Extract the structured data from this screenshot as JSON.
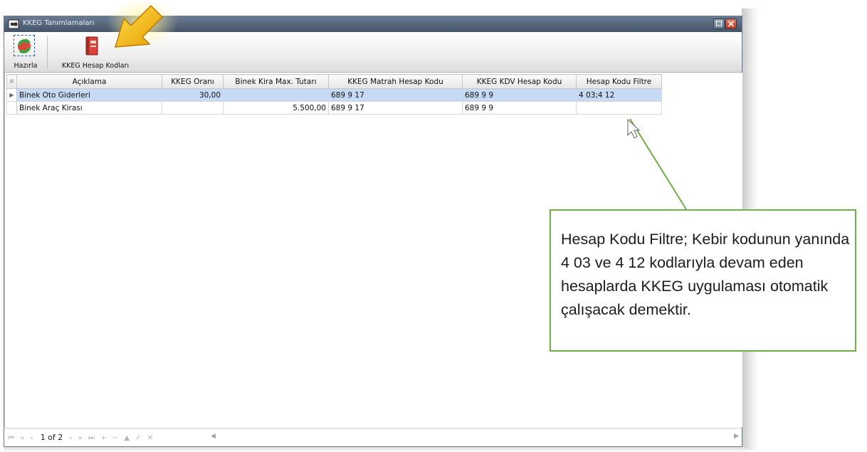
{
  "window": {
    "title": "KKEG Tanımlamaları"
  },
  "toolbar": {
    "buttons": [
      {
        "label": "Hazırla",
        "icon": "refresh-icon"
      },
      {
        "label": "KKEG Hesap Kodları",
        "icon": "book-icon"
      }
    ]
  },
  "grid": {
    "columns": [
      "Açıklama",
      "KKEG Oranı",
      "Binek Kira Max. Tutarı",
      "KKEG Matrah Hesap Kodu",
      "KKEG KDV Hesap Kodu",
      "Hesap Kodu Filtre"
    ],
    "rows": [
      {
        "aciklama": "Binek Oto Giderleri",
        "oran": "30,00",
        "kira": "",
        "matrah": "689 9 17",
        "kdv": "689 9 9",
        "filtre": "4 03;4 12"
      },
      {
        "aciklama": "Binek Araç Kirası",
        "oran": "",
        "kira": "5.500,00",
        "matrah": "689 9 17",
        "kdv": "689 9 9",
        "filtre": ""
      }
    ]
  },
  "navigator": {
    "page_info": "1 of 2"
  },
  "callout": {
    "text": "Hesap Kodu Filtre; Kebir kodunun yanında 4 03 ve 4 12 kodlarıyla devam eden hesaplarda KKEG uygulaması otomatik çalışacak demektir."
  },
  "colors": {
    "title_bar": "#4f6076",
    "selected_row": "#c6daf3",
    "callout_border": "#72ac4b",
    "arrow": "#f2b705"
  }
}
